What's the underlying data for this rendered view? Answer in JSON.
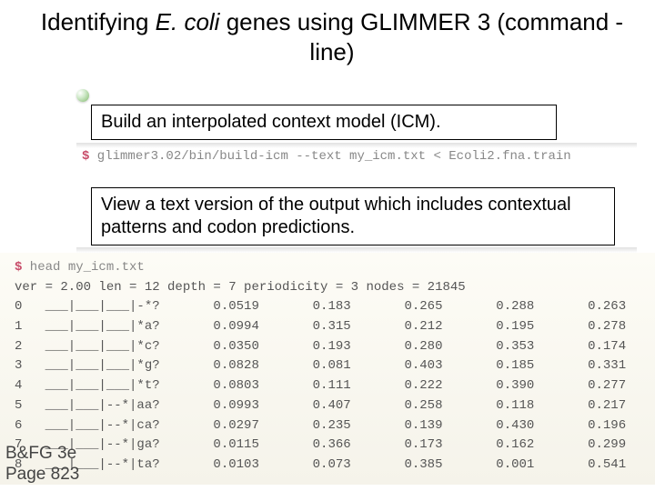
{
  "title": {
    "pre": "Identifying ",
    "ital": "E. coli",
    "post": " genes using GLIMMER 3 (command -line)"
  },
  "section1": "Build an interpolated context model (ICM).",
  "cmd1": {
    "dollar": "$",
    "text": " glimmer3.02/bin/build-icm --text my_icm.txt < Ecoli2.fna.train"
  },
  "section2": "View a text version of the output which includes contextual patterns and codon predictions.",
  "output": {
    "head_dollar": "$",
    "head_cmd": " head my_icm.txt",
    "meta": "ver = 2.00 len = 12 depth = 7 periodicity = 3 nodes = 21845",
    "rows": [
      {
        "idx": "0",
        "pat": "___|___|___|-*?",
        "c1": "0.0519",
        "c2": "0.183",
        "c3": "0.265",
        "c4": "0.288",
        "c5": "0.263"
      },
      {
        "idx": "1",
        "pat": "___|___|___|*a?",
        "c1": "0.0994",
        "c2": "0.315",
        "c3": "0.212",
        "c4": "0.195",
        "c5": "0.278"
      },
      {
        "idx": "2",
        "pat": "___|___|___|*c?",
        "c1": "0.0350",
        "c2": "0.193",
        "c3": "0.280",
        "c4": "0.353",
        "c5": "0.174"
      },
      {
        "idx": "3",
        "pat": "___|___|___|*g?",
        "c1": "0.0828",
        "c2": "0.081",
        "c3": "0.403",
        "c4": "0.185",
        "c5": "0.331"
      },
      {
        "idx": "4",
        "pat": "___|___|___|*t?",
        "c1": "0.0803",
        "c2": "0.111",
        "c3": "0.222",
        "c4": "0.390",
        "c5": "0.277"
      },
      {
        "idx": "5",
        "pat": "___|___|--*|aa?",
        "c1": "0.0993",
        "c2": "0.407",
        "c3": "0.258",
        "c4": "0.118",
        "c5": "0.217"
      },
      {
        "idx": "6",
        "pat": "___|___|--*|ca?",
        "c1": "0.0297",
        "c2": "0.235",
        "c3": "0.139",
        "c4": "0.430",
        "c5": "0.196"
      },
      {
        "idx": "7",
        "pat": "___|___|--*|ga?",
        "c1": "0.0115",
        "c2": "0.366",
        "c3": "0.173",
        "c4": "0.162",
        "c5": "0.299"
      },
      {
        "idx": "8",
        "pat": "___|___|--*|ta?",
        "c1": "0.0103",
        "c2": "0.073",
        "c3": "0.385",
        "c4": "0.001",
        "c5": "0.541"
      }
    ]
  },
  "footer": {
    "line1": "B&FG 3e",
    "line2": "Page 823"
  }
}
